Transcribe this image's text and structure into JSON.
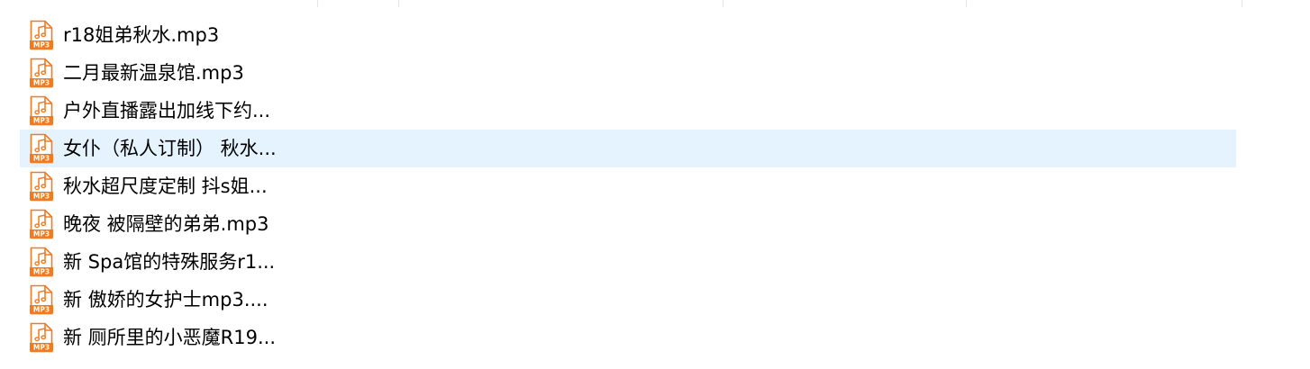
{
  "colors": {
    "selected_row_bg": "#e5f3ff",
    "icon_accent": "#f07b22",
    "column_divider": "#e6e6e6"
  },
  "icon": "mp3-audio-file-icon",
  "icon_label": "MP3",
  "files": [
    {
      "name": "r18姐弟秋水.mp3",
      "selected": false
    },
    {
      "name": "二月最新温泉馆.mp3",
      "selected": false
    },
    {
      "name": "户外直播露出加线下约...",
      "selected": false
    },
    {
      "name": "女仆（私人订制） 秋水...",
      "selected": true
    },
    {
      "name": "秋水超尺度定制 抖s姐...",
      "selected": false
    },
    {
      "name": "晚夜 被隔壁的弟弟.mp3",
      "selected": false
    },
    {
      "name": "新  Spa馆的特殊服务r1...",
      "selected": false
    },
    {
      "name": "新  傲娇的女护士mp3....",
      "selected": false
    },
    {
      "name": "新  厕所里的小恶魔R19...",
      "selected": false
    }
  ]
}
